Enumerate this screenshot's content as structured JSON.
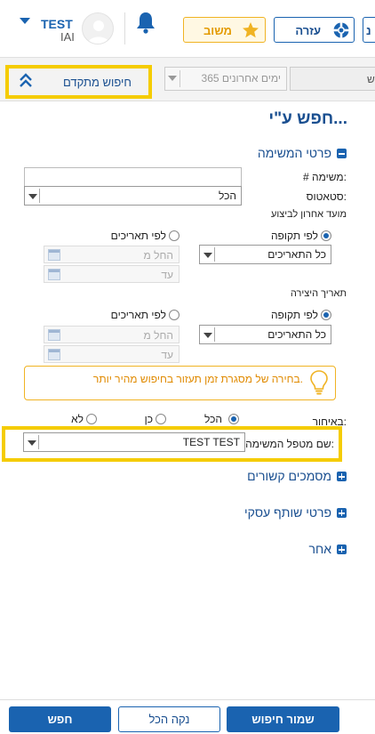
{
  "header": {
    "user_name": "TEST",
    "user_org": "IAI",
    "feedback_label": "משוב",
    "help_label": "עזרה",
    "edge_label": "נ"
  },
  "filter_bar": {
    "advanced_search_label": "חיפוש מתקדם",
    "period_value": "365 ימים אחרונים",
    "right_input_value": "ש"
  },
  "main": {
    "title": "חפש ע\"י...",
    "task_details": {
      "header": "פרטי המשימה",
      "task_number_label": "# משימה:",
      "status_label": "סטאטוס:",
      "status_value": "הכל",
      "due_date_label": "מועד אחרון לביצוע",
      "by_period_label": "לפי תקופה",
      "by_dates_label": "לפי תאריכים",
      "period_value": "כל התאריכים",
      "from_placeholder": "החל מ",
      "to_placeholder": "עד",
      "creation_date_label": "תאריך היצירה",
      "creation_period_value": "כל התאריכים",
      "hint_text": "בחירה של מסגרת זמן תעזור בחיפוש מהיר יותר.",
      "late_label": "באיחור:",
      "late_all": "הכל",
      "late_yes": "כן",
      "late_no": "לא",
      "handler_label": "שם מטפל המשימה:",
      "handler_value": "TEST TEST"
    },
    "sections": {
      "related_docs": "מסמכים קשורים",
      "business_partner": "פרטי שותף עסקי",
      "other": "אחר"
    }
  },
  "footer": {
    "save_search_label": "שמור חיפוש",
    "clear_all_label": "נקה הכל",
    "search_label": "חפש"
  },
  "colors": {
    "brand_blue": "#1a63b0",
    "highlight_yellow": "#f5cc00",
    "warning_orange": "#f0b323"
  }
}
